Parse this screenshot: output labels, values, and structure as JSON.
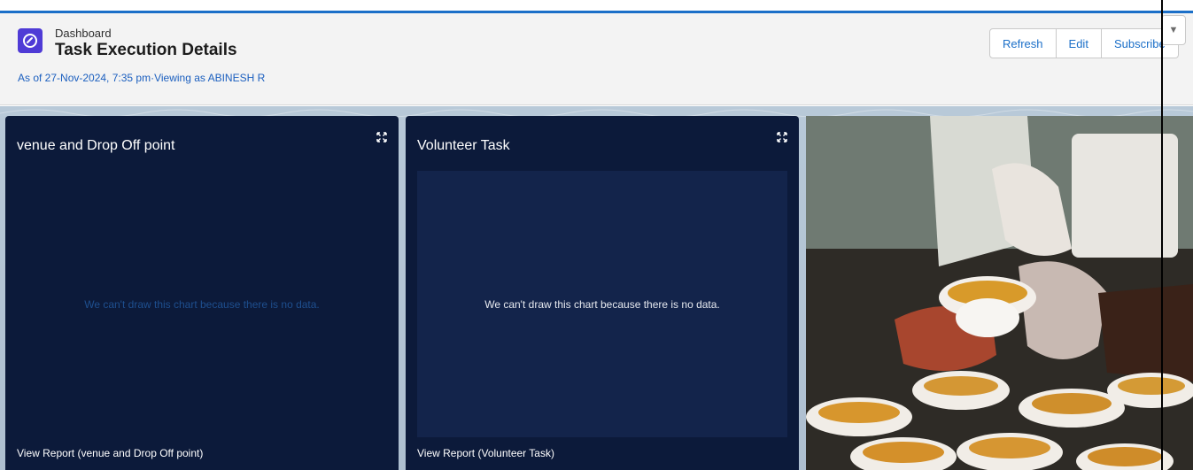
{
  "header": {
    "overline": "Dashboard",
    "title": "Task Execution Details",
    "subtitle": "As of 27-Nov-2024, 7:35 pm·Viewing as ABINESH R",
    "app_icon": "dashboard-gauge-icon"
  },
  "actions": {
    "refresh": "Refresh",
    "edit": "Edit",
    "subscribe": "Subscribe",
    "more_icon": "chevron-down-icon"
  },
  "panels": [
    {
      "title": "venue and Drop Off point",
      "message": "We can't draw this chart because there is no data.",
      "link": "View Report (venue and Drop Off point)"
    },
    {
      "title": "Volunteer Task",
      "message": "We can't draw this chart because there is no data.",
      "link": "View Report (Volunteer Task)"
    }
  ],
  "colors": {
    "accent": "#1b6fc8",
    "panel_bg": "#0c1a3a",
    "panel_inner": "#13244b",
    "icon_bg": "#4f3bd6"
  }
}
